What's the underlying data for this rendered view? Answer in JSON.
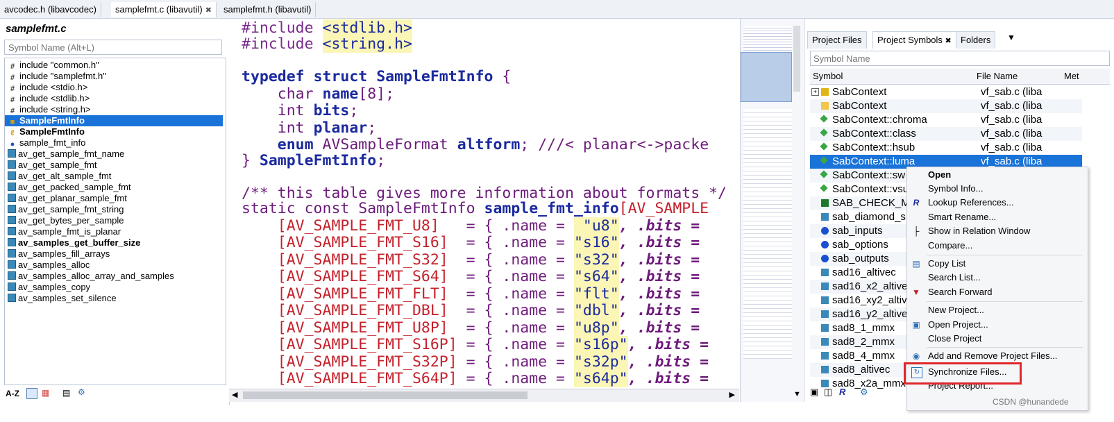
{
  "file_tabs": [
    {
      "label": "avcodec.h (libavcodec)"
    },
    {
      "label": "samplefmt.c (libavutil)",
      "close": "✖"
    },
    {
      "label": "samplefmt.h (libavutil)"
    }
  ],
  "left_panel": {
    "title": "samplefmt.c",
    "search_placeholder": "Symbol Name (Alt+L)",
    "symbols": [
      {
        "label": "include \"common.h\"",
        "icon": "include-icon"
      },
      {
        "label": "include \"samplefmt.h\"",
        "icon": "include-icon"
      },
      {
        "label": "include <stdio.h>",
        "icon": "include-icon"
      },
      {
        "label": "include <stdlib.h>",
        "icon": "include-icon"
      },
      {
        "label": "include <string.h>",
        "icon": "include-icon"
      },
      {
        "label": "SampleFmtInfo",
        "icon": "struct-icon"
      },
      {
        "label": "SampleFmtInfo",
        "icon": "typedef-icon"
      },
      {
        "label": "sample_fmt_info",
        "icon": "variable-icon"
      },
      {
        "label": "av_get_sample_fmt_name",
        "icon": "function-icon"
      },
      {
        "label": "av_get_sample_fmt",
        "icon": "function-icon"
      },
      {
        "label": "av_get_alt_sample_fmt",
        "icon": "function-icon"
      },
      {
        "label": "av_get_packed_sample_fmt",
        "icon": "function-icon"
      },
      {
        "label": "av_get_planar_sample_fmt",
        "icon": "function-icon"
      },
      {
        "label": "av_get_sample_fmt_string",
        "icon": "function-icon"
      },
      {
        "label": "av_get_bytes_per_sample",
        "icon": "function-icon"
      },
      {
        "label": "av_sample_fmt_is_planar",
        "icon": "function-icon"
      },
      {
        "label": "av_samples_get_buffer_size",
        "icon": "function-icon"
      },
      {
        "label": "av_samples_fill_arrays",
        "icon": "function-icon"
      },
      {
        "label": "av_samples_alloc",
        "icon": "function-icon"
      },
      {
        "label": "av_samples_alloc_array_and_samples",
        "icon": "function-icon"
      },
      {
        "label": "av_samples_copy",
        "icon": "function-icon"
      },
      {
        "label": "av_samples_set_silence",
        "icon": "function-icon"
      }
    ],
    "toolbar_sort": "A-Z"
  },
  "editor": {
    "line1_dir": "#include",
    "line1_hdr": "<stdlib.h>",
    "line2_dir": "#include",
    "line2_hdr": "<string.h>",
    "typedef_kw": "typedef",
    "struct_kw": "struct",
    "struct_name": "SampleFmtInfo",
    "brace_open": "{",
    "f1_type": "char",
    "f1_name": "name",
    "f1_rest": "[8];",
    "f2_type": "int",
    "f2_name": "bits",
    "f3_type": "int",
    "f3_name": "planar",
    "f4_kw": "enum",
    "f4_type": "AVSampleFormat",
    "f4_name": "altform",
    "f4_cm": "///< planar<->packe",
    "close_brace": "}",
    "close_name": "SampleFmtInfo",
    "comment": "/** this table gives more information about formats */",
    "static_kw": "static const SampleFmtInfo",
    "table_name": "sample_fmt_info",
    "table_idx": "[AV_SAMPLE",
    "rows": [
      {
        "key": "[AV_SAMPLE_FMT_U8]  ",
        "str": " \"u8\""
      },
      {
        "key": "[AV_SAMPLE_FMT_S16] ",
        "str": "\"s16\""
      },
      {
        "key": "[AV_SAMPLE_FMT_S32] ",
        "str": "\"s32\""
      },
      {
        "key": "[AV_SAMPLE_FMT_S64] ",
        "str": "\"s64\""
      },
      {
        "key": "[AV_SAMPLE_FMT_FLT] ",
        "str": "\"flt\""
      },
      {
        "key": "[AV_SAMPLE_FMT_DBL] ",
        "str": "\"dbl\""
      },
      {
        "key": "[AV_SAMPLE_FMT_U8P] ",
        "str": "\"u8p\""
      },
      {
        "key": "[AV_SAMPLE_FMT_S16P]",
        "str": "\"s16p\""
      },
      {
        "key": "[AV_SAMPLE_FMT_S32P]",
        "str": "\"s32p\""
      },
      {
        "key": "[AV_SAMPLE_FMT_S64P]",
        "str": "\"s64p\""
      }
    ],
    "row_mid": " = { .name = ",
    "row_bits": ", .bits ="
  },
  "right_panel": {
    "tabs": [
      {
        "label": "Project Files"
      },
      {
        "label": "Project Symbols",
        "close": "✖"
      },
      {
        "label": "Folders"
      }
    ],
    "search_placeholder": "Symbol Name",
    "col_symbol": "Symbol",
    "col_file": "File Name",
    "col_met": "Met",
    "rows": [
      {
        "symbol": "SabContext",
        "file": "vf_sab.c (liba"
      },
      {
        "symbol": "SabContext",
        "file": "vf_sab.c (liba"
      },
      {
        "symbol": "SabContext::chroma",
        "file": "vf_sab.c (liba"
      },
      {
        "symbol": "SabContext::class",
        "file": "vf_sab.c (liba"
      },
      {
        "symbol": "SabContext::hsub",
        "file": "vf_sab.c (liba"
      },
      {
        "symbol": "SabContext::luma",
        "file": "vf_sab.c (liba"
      },
      {
        "symbol": "SabContext::sw",
        "file": ""
      },
      {
        "symbol": "SabContext::vsu",
        "file": ""
      },
      {
        "symbol": "SAB_CHECK_M",
        "file": ""
      },
      {
        "symbol": "sab_diamond_s",
        "file": ""
      },
      {
        "symbol": "sab_inputs",
        "file": ""
      },
      {
        "symbol": "sab_options",
        "file": ""
      },
      {
        "symbol": "sab_outputs",
        "file": ""
      },
      {
        "symbol": "sad16_altivec",
        "file": ""
      },
      {
        "symbol": "sad16_x2_altive",
        "file": ""
      },
      {
        "symbol": "sad16_xy2_altiv",
        "file": ""
      },
      {
        "symbol": "sad16_y2_altive",
        "file": ""
      },
      {
        "symbol": "sad8_1_mmx",
        "file": ""
      },
      {
        "symbol": "sad8_2_mmx",
        "file": ""
      },
      {
        "symbol": "sad8_4_mmx",
        "file": ""
      },
      {
        "symbol": "sad8_altivec",
        "file": ""
      },
      {
        "symbol": "sad8_x2a_mmx",
        "file": ""
      }
    ]
  },
  "context_menu": {
    "items": [
      {
        "label": "Open"
      },
      {
        "label": "Symbol Info..."
      },
      {
        "label": "Lookup References..."
      },
      {
        "label": "Smart Rename..."
      },
      {
        "label": "Show in Relation Window"
      },
      {
        "label": "Compare..."
      },
      {
        "label": "Copy List"
      },
      {
        "label": "Search List..."
      },
      {
        "label": "Search Forward"
      },
      {
        "label": "New Project..."
      },
      {
        "label": "Open Project..."
      },
      {
        "label": "Close Project"
      },
      {
        "label": "Add and Remove Project Files..."
      },
      {
        "label": "Synchronize Files..."
      },
      {
        "label": "Project Report..."
      }
    ]
  },
  "watermark": "CSDN @hunandede",
  "colors": {
    "selection": "#1a73d8",
    "highlight_box": "#e0262b",
    "string_bg": "#fbf6b5"
  }
}
